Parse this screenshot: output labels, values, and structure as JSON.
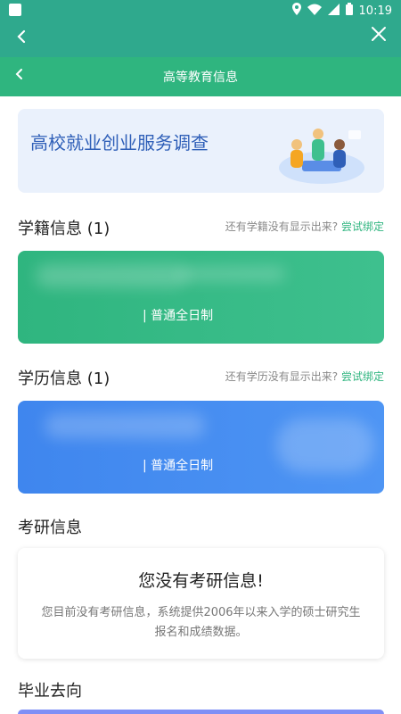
{
  "status_bar": {
    "time": "10:19",
    "icons": [
      "notification-icon",
      "location-icon",
      "wifi-icon",
      "signal-icon",
      "battery-icon"
    ]
  },
  "app_bar": {
    "back_icon": "chevron-left-icon",
    "close_icon": "close-icon"
  },
  "web_header": {
    "title": "高等教育信息",
    "back_icon": "chevron-left-icon"
  },
  "banner": {
    "title": "高校就业创业服务调查",
    "illustration": "team-meeting-illustration"
  },
  "enrollment": {
    "title": "学籍信息 (1)",
    "hint": "还有学籍没有显示出来?",
    "link": "尝试绑定",
    "card": {
      "line": "|  普通全日制"
    }
  },
  "education": {
    "title": "学历信息 (1)",
    "hint": "还有学历没有显示出来?",
    "link": "尝试绑定",
    "card": {
      "line": "|  普通全日制"
    }
  },
  "postgrad": {
    "title": "考研信息",
    "notice_title": "您没有考研信息!",
    "notice_body": "您目前没有考研信息，系统提供2006年以来入学的硕士研究生报名和成绩数据。"
  },
  "destination": {
    "title": "毕业去向"
  },
  "colors": {
    "header_teal": "#2fa98d",
    "header_green": "#2fb57f",
    "card_green": "#2fb57f",
    "card_blue": "#3f86ee",
    "banner_bg": "#eaf1fc",
    "banner_text": "#2f5fb8",
    "link_green": "#2fb57f"
  }
}
